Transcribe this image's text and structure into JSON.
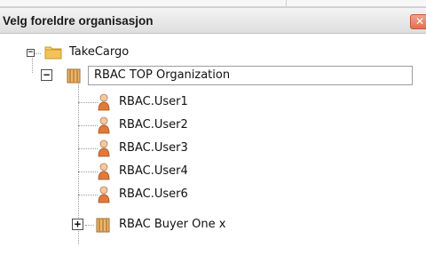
{
  "dialog": {
    "title": "Velg foreldre organisasjon",
    "close_glyph": "✕"
  },
  "tree": {
    "root": {
      "label": "TakeCargo",
      "icon": "folder-icon",
      "expanded": true
    },
    "org": {
      "label": "RBAC TOP Organization",
      "icon": "organization-icon",
      "expanded": true,
      "selected": true
    },
    "users": [
      {
        "label": "RBAC.User1",
        "icon": "user-icon"
      },
      {
        "label": "RBAC.User2",
        "icon": "user-icon"
      },
      {
        "label": "RBAC.User3",
        "icon": "user-icon"
      },
      {
        "label": "RBAC.User4",
        "icon": "user-icon"
      },
      {
        "label": "RBAC.User6",
        "icon": "user-icon"
      }
    ],
    "buyer": {
      "label": "RBAC Buyer One x",
      "icon": "organization-icon",
      "expanded": false
    },
    "expand_glyph": "+",
    "collapse_glyph": "−"
  },
  "colors": {
    "folder": "#f3c35a",
    "org_book": "#c98a3e",
    "user_body": "#e07a3a",
    "user_head": "#f2c9a3",
    "close": "#e0714f"
  }
}
